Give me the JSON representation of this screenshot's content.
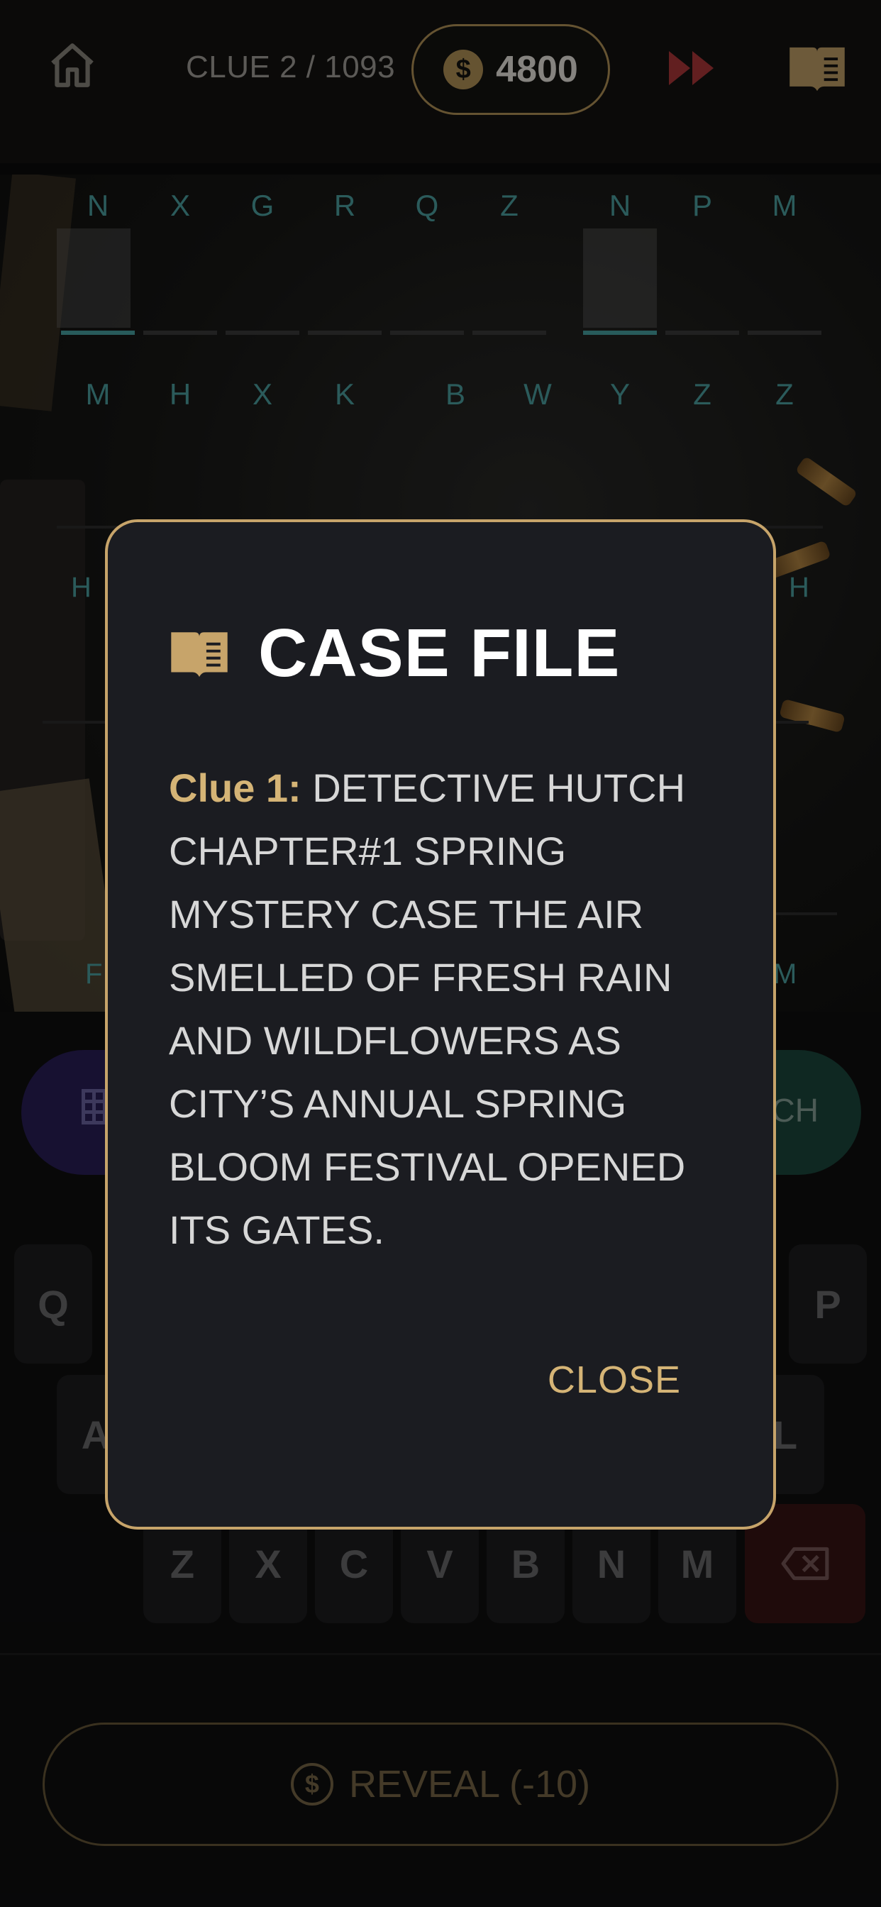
{
  "header": {
    "clue_counter": "CLUE 2 / 1093",
    "coins": "4800",
    "coin_symbol": "$"
  },
  "board": {
    "top_cipher": [
      "N",
      "X",
      "G",
      "R",
      "Q",
      "Z",
      "",
      "N",
      "P",
      "M"
    ],
    "second_cipher": [
      "M",
      "H",
      "X",
      "K",
      "",
      "B",
      "W",
      "Y",
      "Z",
      "Z"
    ],
    "edge_letters": {
      "left_1": "H",
      "right_1": "H",
      "left_2": "F",
      "right_2": "M"
    }
  },
  "controls": {
    "right_pill_fragment": "CH"
  },
  "keyboard": {
    "row1_visible": [
      "Q",
      "P"
    ],
    "row2_visible": [
      "A",
      "L"
    ],
    "row3": [
      "Z",
      "X",
      "C",
      "V",
      "B",
      "N",
      "M"
    ]
  },
  "reveal": {
    "label": "REVEAL (-10)",
    "coin_symbol": "$"
  },
  "modal": {
    "title": "CASE FILE",
    "clue_label": "Clue 1:",
    "clue_text": "DETECTIVE HUTCH CHAPTER#1 SPRING MYSTERY CASE THE AIR SMELLED OF FRESH RAIN AND WILDFLOWERS AS CITY’S ANNUAL SPRING BLOOM FESTIVAL OPENED ITS GATES.",
    "close_label": "CLOSE"
  },
  "colors": {
    "accent_gold": "#c7a46a",
    "cipher_teal": "#4fa7a7",
    "fast_forward_red": "#b3393b",
    "modal_bg": "#1b1c21"
  },
  "icons": [
    "home-icon",
    "coin-icon",
    "fast-forward-icon",
    "book-icon",
    "grid-icon",
    "backspace-icon"
  ]
}
